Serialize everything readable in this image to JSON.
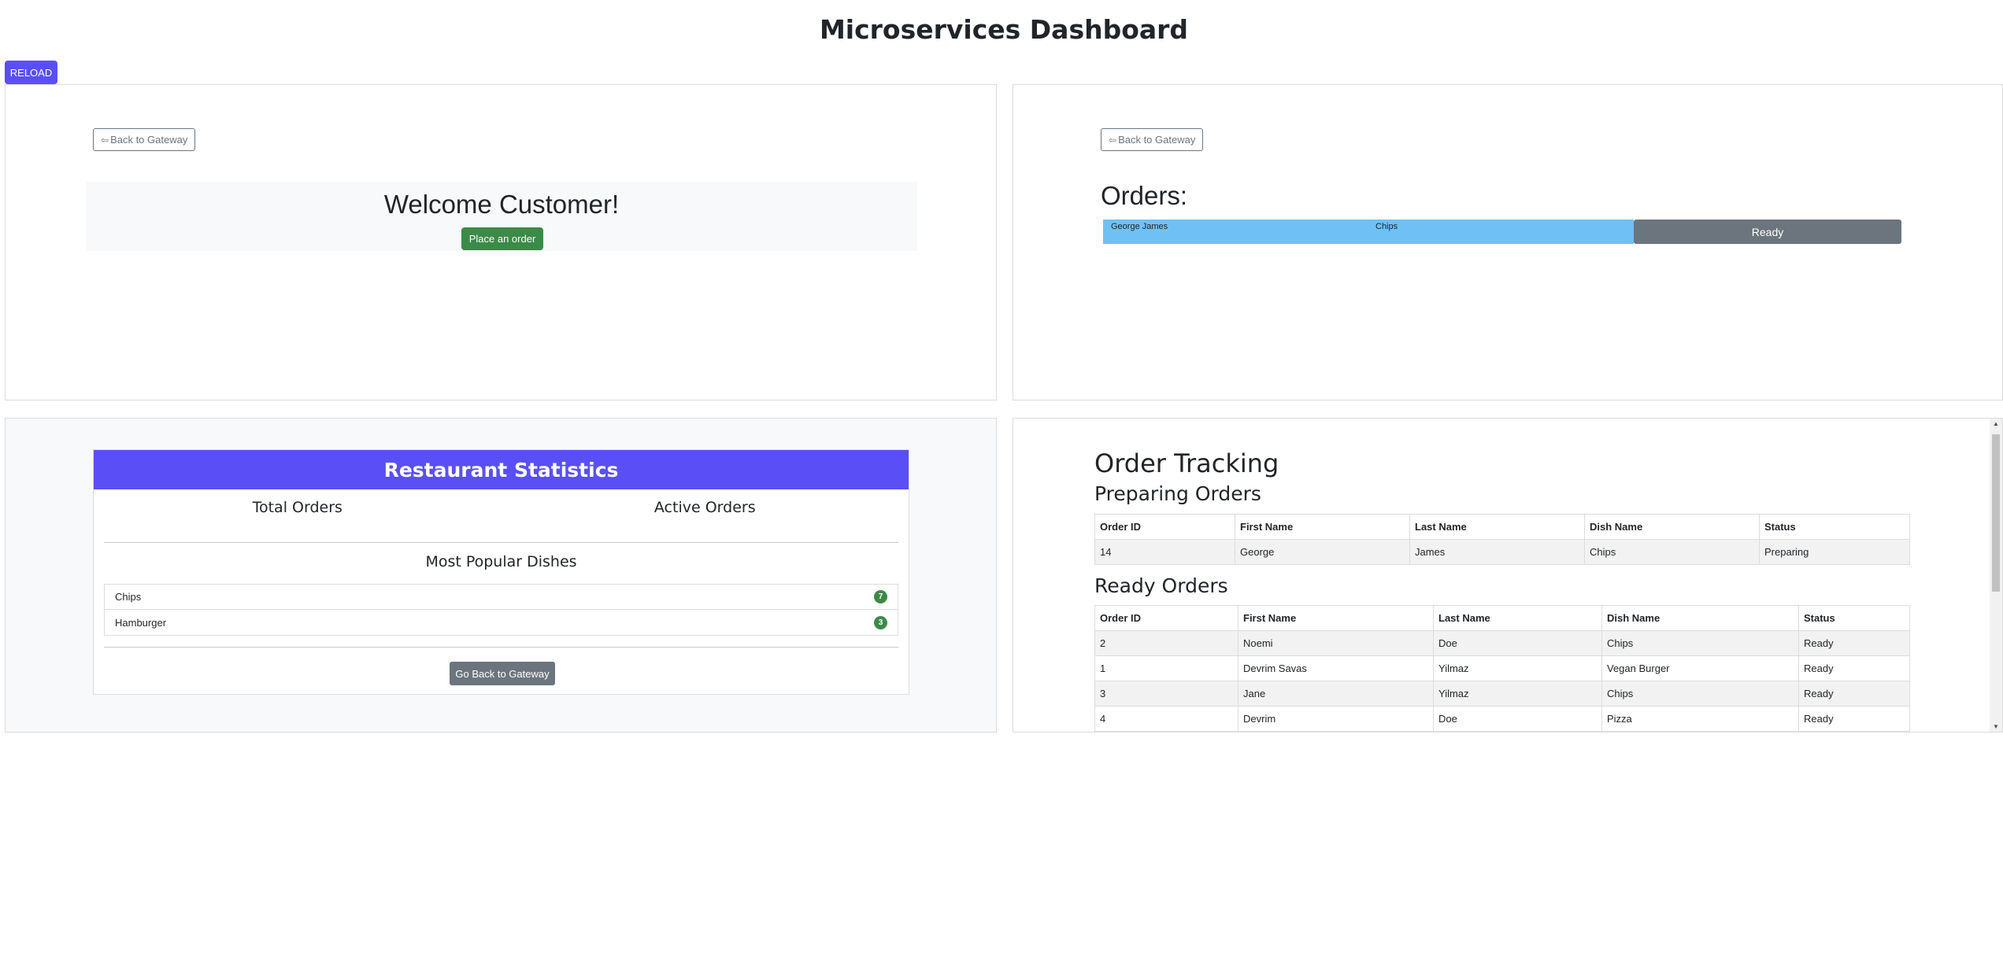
{
  "page": {
    "title": "Microservices Dashboard",
    "reload_label": "RELOAD"
  },
  "customer": {
    "back_label": "Back to Gateway",
    "welcome": "Welcome Customer!",
    "place_order_label": "Place an order"
  },
  "orders": {
    "back_label": "Back to Gateway",
    "title": "Orders:",
    "items": [
      {
        "name": "George James",
        "dish": "Chips",
        "status": "Ready"
      }
    ],
    "colors": {
      "bar": "#6fc1f5",
      "status_button": "#6c757d"
    }
  },
  "stats": {
    "title": "Restaurant Statistics",
    "total_orders_label": "Total Orders",
    "active_orders_label": "Active Orders",
    "popular_title": "Most Popular Dishes",
    "dishes": [
      {
        "name": "Chips",
        "count": "7"
      },
      {
        "name": "Hamburger",
        "count": "3"
      }
    ],
    "back_label": "Go Back to Gateway",
    "colors": {
      "header": "#5a4ff7",
      "badge": "#3c8a47"
    }
  },
  "tracking": {
    "title": "Order Tracking",
    "preparing_title": "Preparing Orders",
    "ready_title": "Ready Orders",
    "columns": [
      "Order ID",
      "First Name",
      "Last Name",
      "Dish Name",
      "Status"
    ],
    "preparing": [
      [
        "14",
        "George",
        "James",
        "Chips",
        "Preparing"
      ]
    ],
    "ready": [
      [
        "2",
        "Noemi",
        "Doe",
        "Chips",
        "Ready"
      ],
      [
        "1",
        "Devrim Savas",
        "Yilmaz",
        "Vegan Burger",
        "Ready"
      ],
      [
        "3",
        "Jane",
        "Yilmaz",
        "Chips",
        "Ready"
      ],
      [
        "4",
        "Devrim",
        "Doe",
        "Pizza",
        "Ready"
      ]
    ]
  }
}
